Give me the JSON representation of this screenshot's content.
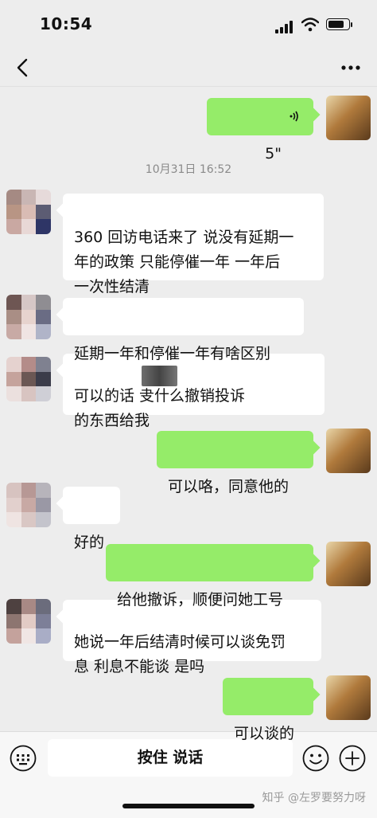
{
  "status_bar": {
    "time": "10:54"
  },
  "timestamp": "10月31日 16:52",
  "messages": [
    {
      "dir": "out",
      "text": "5\""
    },
    {
      "dir": "in",
      "text": "360 回访电话来了 说没有延期一\n年的政策 只能停催一年 一年后\n一次性结清"
    },
    {
      "dir": "in",
      "text": "延期一年和停催一年有啥区别"
    },
    {
      "dir": "in",
      "text": "可以的话            叏什么撤销投诉\n的东西给我"
    },
    {
      "dir": "out",
      "text": "可以咯，同意他的"
    },
    {
      "dir": "in",
      "text": "好的"
    },
    {
      "dir": "out",
      "text": "给他撤诉，顺便问她工号"
    },
    {
      "dir": "in",
      "text": "她说一年后结清时候可以谈免罚\n息 利息不能谈 是吗"
    },
    {
      "dir": "out",
      "text": "可以谈的"
    }
  ],
  "input_bar": {
    "hold_to_talk": "按住 说话"
  },
  "watermark": "知乎 @左罗要努力呀",
  "icons": {
    "back": "chevron-left-icon",
    "more": "ellipsis-icon",
    "voice_wave": "voice-wave-icon",
    "keyboard": "keyboard-icon",
    "emoji": "emoji-icon",
    "plus": "plus-icon"
  },
  "colors": {
    "background": "#ededed",
    "outgoing_bubble": "#95ec69",
    "incoming_bubble": "#ffffff"
  }
}
